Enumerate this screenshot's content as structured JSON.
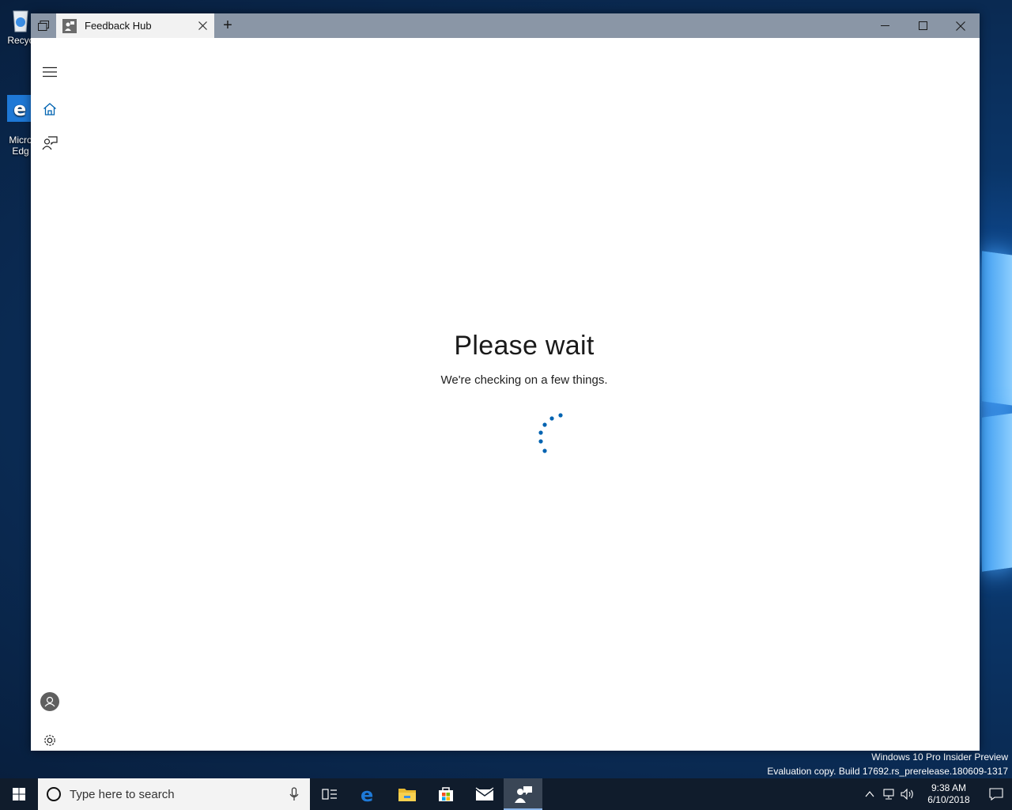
{
  "desktop": {
    "icons": [
      {
        "label": "Recyc"
      },
      {
        "label": "Micro\nEdg"
      }
    ]
  },
  "window": {
    "tab_title": "Feedback Hub",
    "new_tab_symbol": "+",
    "nav": [
      "menu-icon",
      "home-icon",
      "feedback-icon",
      "account-icon",
      "settings-icon"
    ],
    "accent": "#0063b1"
  },
  "content": {
    "title": "Please wait",
    "subtitle": "We're checking on a few things."
  },
  "watermark": {
    "line1": "Windows 10 Pro Insider Preview",
    "line2": "Evaluation copy. Build 17692.rs_prerelease.180609-1317"
  },
  "taskbar": {
    "search_placeholder": "Type here to search",
    "apps": [
      "task-view-icon",
      "edge-icon",
      "file-explorer-icon",
      "store-icon",
      "mail-icon",
      "feedback-hub-icon"
    ],
    "time": "9:38 AM",
    "date": "6/10/2018"
  }
}
